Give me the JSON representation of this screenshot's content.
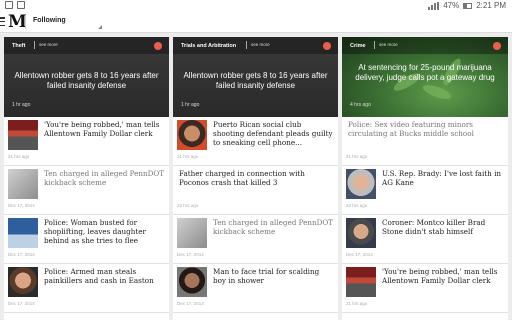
{
  "status_bar": {
    "battery": "47%",
    "time": "2:21 PM"
  },
  "app": {
    "logo": "M",
    "section": "Following"
  },
  "columns": [
    {
      "tag": "Theft",
      "see_more": "see more",
      "hero": {
        "title": "Allentown robber gets 8 to 16 years after failed insanity defense",
        "time": "1 hr ago"
      },
      "items": [
        {
          "headline": "'You're being robbed,' man tells Allentown Family Dollar clerk",
          "time": "21 hrs ago",
          "thumb": "store-photo"
        },
        {
          "headline": "Ten charged in alleged PennDOT kickback scheme",
          "time": "Dec 17, 2014",
          "thumb": "office-photo"
        },
        {
          "headline": "Police: Woman busted for shoplifting, leaves daughter behind as she tries to flee",
          "time": "Dec 17, 2014",
          "thumb": "walmart-photo"
        },
        {
          "headline": "Police: Armed man steals painkillers and cash in Easton",
          "time": "Dec 17, 2014",
          "thumb": "mugshot"
        }
      ]
    },
    {
      "tag": "Trials and Arbitration",
      "see_more": "see more",
      "hero": {
        "title": "Allentown robber gets 8 to 16 years after failed insanity defense",
        "time": "1 hr ago"
      },
      "items": [
        {
          "headline": "Puerto Rican social club shooting defendant pleads guilty to sneaking cell phone...",
          "time": "21 hrs ago",
          "thumb": "mugshot"
        },
        {
          "headline": "Father charged in connection with Poconos crash that killed 3",
          "time": "22 hrs ago",
          "thumb": ""
        },
        {
          "headline": "Ten charged in alleged PennDOT kickback scheme",
          "time": "Dec 17, 2014",
          "thumb": "office-photo"
        },
        {
          "headline": "Man to face trial for scalding boy in shower",
          "time": "Dec 17, 2014",
          "thumb": "mugshot"
        }
      ]
    },
    {
      "tag": "Crime",
      "see_more": "see more",
      "hero": {
        "title": "At sentencing for 25-pound marijuana delivery, judge calls pot a gateway drug",
        "time": "4 hrs ago"
      },
      "items": [
        {
          "headline": "Police: Sex video featuring minors circulating at Bucks middle school",
          "time": "21 hrs ago",
          "thumb": ""
        },
        {
          "headline": "U.S. Rep. Brady: I've lost faith in AG Kane",
          "time": "22 hrs ago",
          "thumb": "portrait"
        },
        {
          "headline": "Coroner: Montco killer Brad Stone didn't stab himself",
          "time": "Dec 17, 2014",
          "thumb": "mugshot"
        },
        {
          "headline": "'You're being robbed,' man tells Allentown Family Dollar clerk",
          "time": "21 hrs ago",
          "thumb": "store-photo"
        }
      ]
    }
  ]
}
